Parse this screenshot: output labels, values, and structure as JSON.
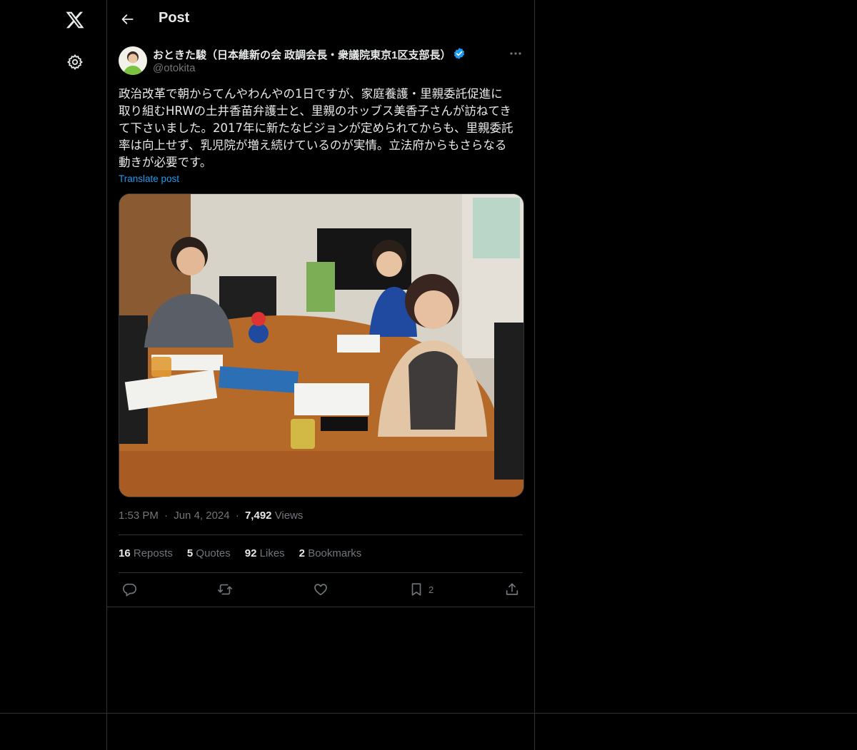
{
  "nav": {
    "logo_icon": "x-logo-icon",
    "settings_icon": "gear-icon"
  },
  "header": {
    "title": "Post"
  },
  "author": {
    "name": "おときた駿（日本維新の会 政調会長・衆議院東京1区支部長）",
    "handle": "@otokita",
    "verified": true
  },
  "post": {
    "lines": [
      "政治改革で朝からてんやわんやの1日ですが、家庭養護・里親委託促進に",
      "取り組むHRWの土井香苗弁護士と、里親のホッブス美香子さんが訪ねてき",
      "て下さいました。2017年に新たなビジョンが定められてからも、里親委託",
      "率は向上せず、乳児院が増え続けているのが実情。立法府からもさらなる",
      "動きが必要です。"
    ],
    "translate_label": "Translate post"
  },
  "meta": {
    "time": "1:53 PM",
    "date": "Jun 4, 2024",
    "views_count": "7,492",
    "views_label": "Views",
    "dot": "·"
  },
  "stats": {
    "reposts_count": "16",
    "reposts_label": "Reposts",
    "quotes_count": "5",
    "quotes_label": "Quotes",
    "likes_count": "92",
    "likes_label": "Likes",
    "bookmarks_count": "2",
    "bookmarks_label": "Bookmarks"
  },
  "actions": {
    "bookmark_count": "2"
  },
  "colors": {
    "accent": "#1d9bf0",
    "background": "#000000",
    "border": "#2f3336",
    "muted": "#71767b"
  }
}
